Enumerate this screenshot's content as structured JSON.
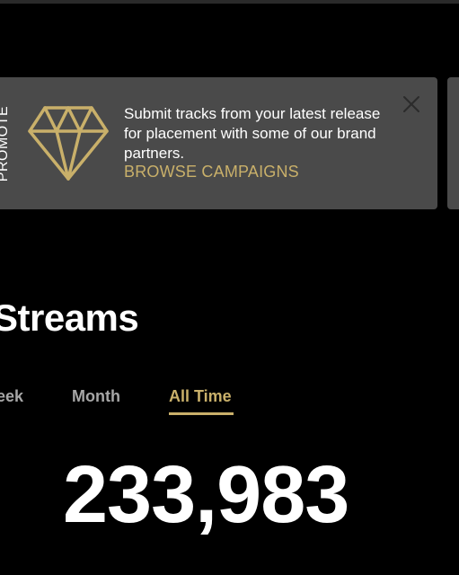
{
  "promo": {
    "side_label": "PROMOTE",
    "icon": "diamond-icon",
    "message": "Submit tracks from your latest release for placement with some of our brand partners.",
    "cta_label": "BROWSE CAMPAIGNS",
    "close_icon": "close-icon"
  },
  "streams": {
    "title": "Streams",
    "tabs": [
      {
        "label": "eek",
        "selected": false
      },
      {
        "label": "Month",
        "selected": false
      },
      {
        "label": "All Time",
        "selected": true
      }
    ],
    "total": "233,983"
  },
  "colors": {
    "background": "#000000",
    "card": "#4a4a4a",
    "accent_gold": "#c9b06a",
    "text_primary": "#ffffff",
    "text_muted": "#a6a6a6"
  }
}
